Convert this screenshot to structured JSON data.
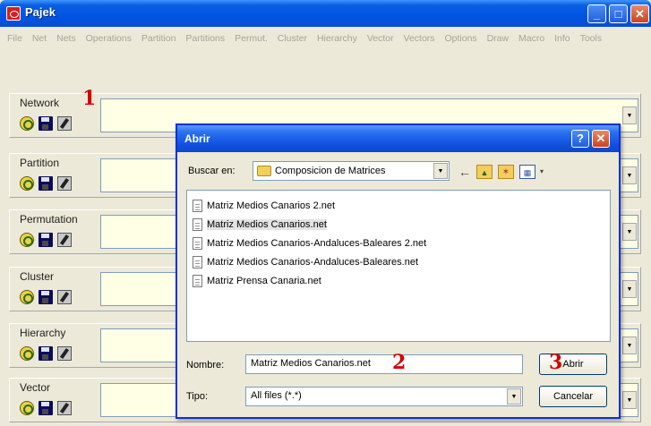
{
  "window": {
    "title": "Pajek"
  },
  "menu": [
    "File",
    "Net",
    "Nets",
    "Operations",
    "Partition",
    "Partitions",
    "Permut.",
    "Cluster",
    "Hierarchy",
    "Vector",
    "Vectors",
    "Options",
    "Draw",
    "Macro",
    "Info",
    "Tools"
  ],
  "panels": [
    {
      "label": "Network"
    },
    {
      "label": "Partition"
    },
    {
      "label": "Permutation"
    },
    {
      "label": "Cluster"
    },
    {
      "label": "Hierarchy"
    },
    {
      "label": "Vector"
    }
  ],
  "annotations": {
    "one": "1",
    "two": "2",
    "three": "3"
  },
  "dialog": {
    "title": "Abrir",
    "help_glyph": "?",
    "close_glyph": "✕",
    "look_in_label": "Buscar en:",
    "look_in_value": "Composicion de Matrices",
    "files": [
      "Matriz Medios Canarios 2.net",
      "Matriz Medios Canarios.net",
      "Matriz Medios Canarios-Andaluces-Baleares 2.net",
      "Matriz Medios Canarios-Andaluces-Baleares.net",
      "Matriz Prensa Canaria.net"
    ],
    "selected_file_index": 1,
    "name_label": "Nombre:",
    "name_value": "Matriz Medios Canarios.net",
    "type_label": "Tipo:",
    "type_value": "All files (*.*)",
    "open_button": "Abrir",
    "cancel_button": "Cancelar"
  },
  "colors": {
    "title_blue": "#0054e3",
    "combo_fill": "#ffffe6",
    "annotation_red": "#d40000"
  }
}
